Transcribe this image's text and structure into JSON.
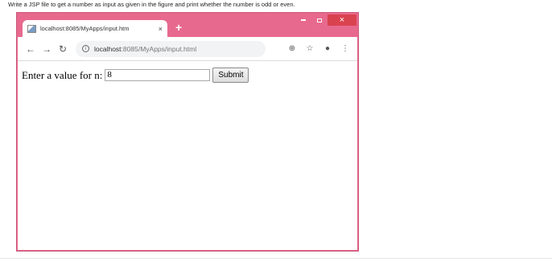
{
  "question": "Write a JSP file to get a number as input  as given in the figure and print whether the number is odd or even.",
  "browser": {
    "tab_title": "localhost:8085/MyApps/input.htm",
    "tab_close": "×",
    "new_tab": "+",
    "url_host": "localhost",
    "url_rest": ":8085/MyApps/input.html",
    "window_close": "×"
  },
  "form": {
    "label": "Enter a value for n:",
    "input_value": "8",
    "submit_label": "Submit"
  },
  "colors": {
    "frame": "#e8698e",
    "close": "#d9424f"
  },
  "icons": [
    "back-icon",
    "forward-icon",
    "reload-icon",
    "info-icon",
    "zoom-icon",
    "star-icon",
    "account-icon",
    "menu-icon"
  ]
}
